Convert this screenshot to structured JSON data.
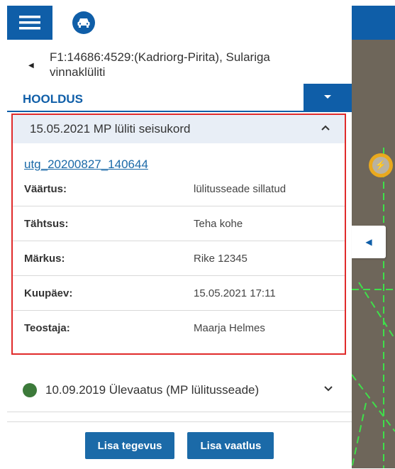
{
  "header": {
    "menu_icon": "hamburger-menu-icon",
    "car_icon": "car-icon"
  },
  "title": {
    "line1": "F1:14686:4529:(Kadriorg-Pirita), Sulariga",
    "line2": "vinnaklüliti"
  },
  "section": {
    "title": "HOOLDUS"
  },
  "expanded_item": {
    "header": "15.05.2021 MP lüliti seisukord",
    "link": "utg_20200827_140644",
    "rows": [
      {
        "label": "Väärtus:",
        "value": "lülitusseade sillatud"
      },
      {
        "label": "Tähtsus:",
        "value": "Teha kohe"
      },
      {
        "label": "Märkus:",
        "value": "Rike 12345"
      },
      {
        "label": "Kuupäev:",
        "value": "15.05.2021 17:11"
      },
      {
        "label": "Teostaja:",
        "value": "Maarja Helmes"
      }
    ]
  },
  "collapsed_item": {
    "status_color": "#3c7a3a",
    "label": "10.09.2019 Ülevaatus (MP lülitusseade)"
  },
  "footer": {
    "add_action": "Lisa tegevus",
    "add_inspection": "Lisa vaatlus"
  },
  "colors": {
    "primary": "#0f5ea8",
    "highlight_border": "#e02b2b"
  }
}
